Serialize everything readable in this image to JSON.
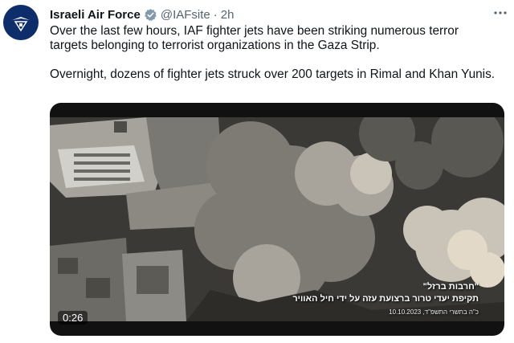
{
  "tweet": {
    "author_name": "Israeli Air Force",
    "handle": "@IAFsite",
    "separator": "·",
    "timestamp": "2h",
    "paragraphs": [
      "Over the last few hours, IAF fighter jets have been striking numerous terror targets belonging to terrorist organizations in the Gaza Strip.",
      "Overnight, dozens of fighter jets struck over 200 targets in Rimal and Khan Yunis."
    ]
  },
  "video": {
    "duration": "0:26",
    "overlay_title": "\"חרבות ברזל\"",
    "overlay_subtitle": "תקיפת יעדי טרור ברצועת עזה על ידי חיל האוויר",
    "overlay_date": "10.10.2023 ,כ\"ה בתשרי התשפ\"ד"
  },
  "icons": {
    "avatar": "iaf-emblem-icon",
    "verified": "verified-badge-icon",
    "more": "more-options-icon"
  },
  "colors": {
    "verified": "#829aab",
    "avatar_bg": "#0d2d6b",
    "secondary_text": "#536471"
  }
}
